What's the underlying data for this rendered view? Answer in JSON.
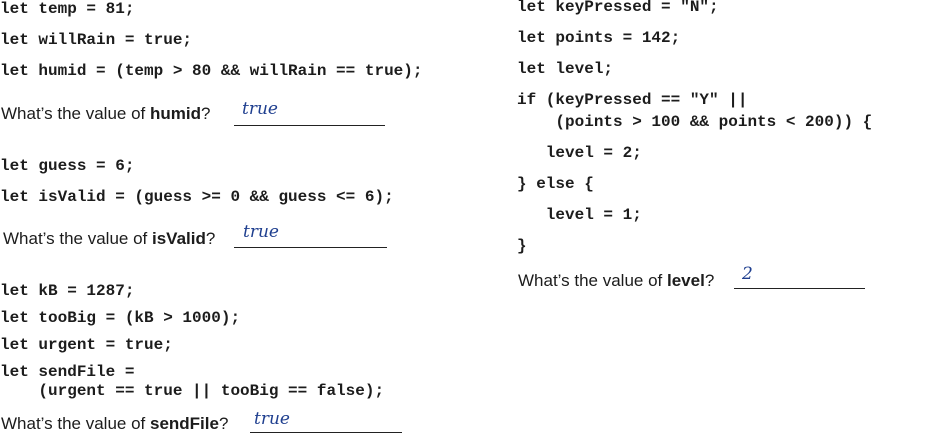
{
  "left": {
    "block1": {
      "lines": [
        "let temp = 81;",
        "let willRain = true;",
        "let humid = (temp > 80 && willRain == true);"
      ],
      "question_prefix": "What’s the value of ",
      "question_var": "humid",
      "question_suffix": "?",
      "answer": "true"
    },
    "block2": {
      "lines": [
        "let guess = 6;",
        "let isValid = (guess >= 0 && guess <= 6);"
      ],
      "question_prefix": "What’s the value of ",
      "question_var": "isValid",
      "question_suffix": "?",
      "answer": "true"
    },
    "block3": {
      "lines": [
        "let kB = 1287;",
        "let tooBig = (kB > 1000);",
        "let urgent = true;",
        "let sendFile =",
        "    (urgent == true || tooBig == false);"
      ],
      "question_prefix": "What’s the value of ",
      "question_var": "sendFile",
      "question_suffix": "?",
      "answer": "true"
    }
  },
  "right": {
    "block4": {
      "lines": [
        "let keyPressed = \"N\";",
        "let points = 142;",
        "let level;",
        "if (keyPressed == \"Y\" ||",
        "    (points > 100 && points < 200)) {",
        "   level = 2;",
        "} else {",
        "   level = 1;",
        "}"
      ],
      "question_prefix": "What’s the value of ",
      "question_var": "level",
      "question_suffix": "?",
      "answer": "2"
    }
  },
  "colors": {
    "ink": "#1c1c1c",
    "handwriting": "#1f3f8f"
  }
}
